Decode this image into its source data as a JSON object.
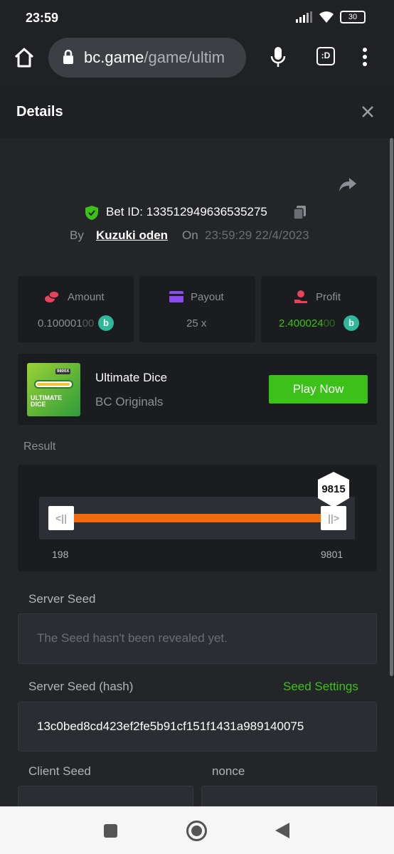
{
  "status": {
    "time": "23:59",
    "battery": "30"
  },
  "browser": {
    "url_domain": "bc.game",
    "url_path": "/game/ultim",
    "tab_label": ":D"
  },
  "details": {
    "title": "Details"
  },
  "bet": {
    "id_label": "Bet ID:",
    "id": "133512949636535275",
    "by_label": "By",
    "user": "Kuzuki oden",
    "on_label": "On",
    "datetime": "23:59:29 22/4/2023"
  },
  "stats": {
    "amount_label": "Amount",
    "amount_main": "0.100001",
    "amount_dim": "00",
    "payout_label": "Payout",
    "payout_value": "25 x",
    "profit_label": "Profit",
    "profit_main": "2.400024",
    "profit_dim": "00"
  },
  "game": {
    "thumb_badge": "9800X",
    "thumb_title_line1": "ULTIMATE",
    "thumb_title_line2": "DICE",
    "name": "Ultimate Dice",
    "provider": "BC Originals",
    "play_label": "Play Now"
  },
  "result": {
    "label": "Result",
    "marker": "9815",
    "range_low": "198",
    "range_high": "9801",
    "handle_left_glyph": "<||",
    "handle_right_glyph": "||>"
  },
  "seeds": {
    "server_label": "Server Seed",
    "server_placeholder": "The Seed hasn't been revealed yet.",
    "hash_label": "Server Seed (hash)",
    "settings_link": "Seed Settings",
    "hash_value": "13c0bed8cd423ef2fe5b91cf151f1431a989140075",
    "client_label": "Client Seed",
    "nonce_label": "nonce"
  },
  "colors": {
    "accent_green": "#3bc117",
    "orange": "#f16a0c",
    "profit_green": "#3bc117"
  }
}
